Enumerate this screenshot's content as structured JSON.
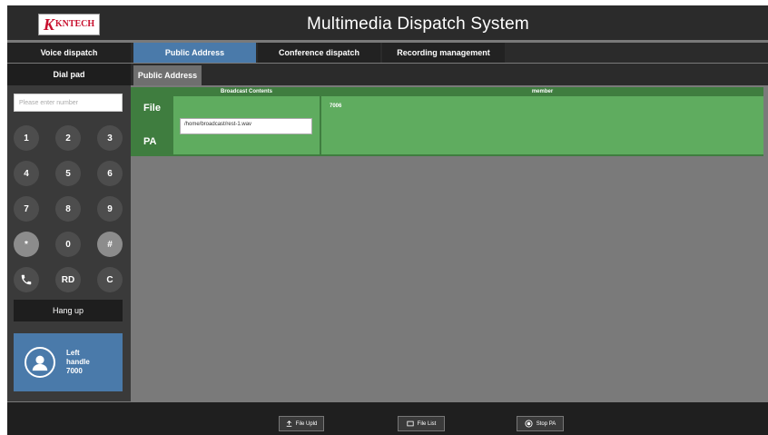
{
  "header": {
    "logo_text": "KNTECH",
    "title": "Multimedia Dispatch System"
  },
  "tabs": [
    {
      "label": "Voice dispatch"
    },
    {
      "label": "Public Address"
    },
    {
      "label": "Conference dispatch"
    },
    {
      "label": "Recording management"
    }
  ],
  "dialpad": {
    "title": "Dial pad",
    "placeholder": "Please enter number",
    "keys": [
      "1",
      "2",
      "3",
      "4",
      "5",
      "6",
      "7",
      "8",
      "9",
      "*",
      "0",
      "#",
      "",
      "RD",
      "C"
    ],
    "hangup": "Hang up"
  },
  "handle": {
    "line1": "Left",
    "line2": "handle",
    "line3": "7000"
  },
  "subtab": "Public Address",
  "table": {
    "col_broadcast": "Broadcast Contents",
    "col_member": "member",
    "row_file": "File",
    "row_pa": "PA",
    "file_value": "/home/broadcast/rest-1.wav",
    "member_value": "7006"
  },
  "footer": {
    "upload": "File Upld",
    "list": "File List",
    "stop": "Stop PA"
  },
  "colors": {
    "accent_blue": "#4a7aaa",
    "pa_green": "#5fac5f",
    "logo_red": "#c8102e"
  }
}
